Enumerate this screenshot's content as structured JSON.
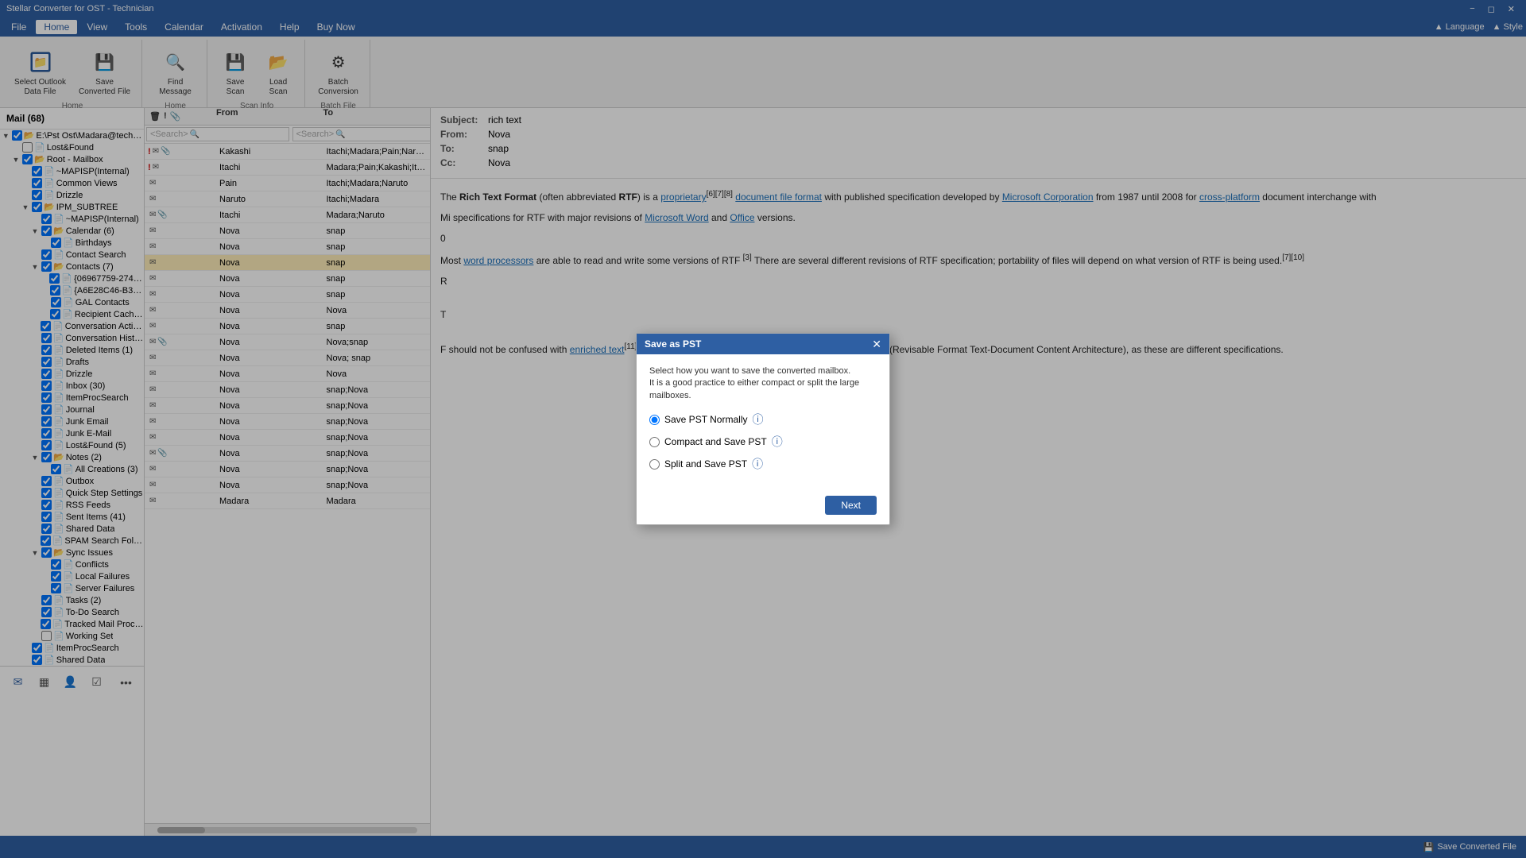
{
  "titleBar": {
    "title": "Stellar Converter for OST - Technician",
    "controls": [
      "minimize",
      "restore",
      "close"
    ]
  },
  "menuBar": {
    "items": [
      {
        "label": "File",
        "active": false
      },
      {
        "label": "Home",
        "active": true
      },
      {
        "label": "View",
        "active": false
      },
      {
        "label": "Tools",
        "active": false
      },
      {
        "label": "Calendar",
        "active": false
      },
      {
        "label": "Activation",
        "active": false
      },
      {
        "label": "Help",
        "active": false
      },
      {
        "label": "Buy Now",
        "active": false
      }
    ],
    "right": [
      {
        "label": "▲ Language"
      },
      {
        "label": "▲ Style"
      }
    ]
  },
  "ribbon": {
    "groups": [
      {
        "label": "Home",
        "buttons": [
          {
            "id": "select-outlook",
            "icon": "📁",
            "label": "Select Outlook\nData File"
          },
          {
            "id": "save-converted",
            "icon": "💾",
            "label": "Save\nConverted File"
          }
        ]
      },
      {
        "label": "Home",
        "buttons": [
          {
            "id": "find-message",
            "icon": "🔍",
            "label": "Find\nMessage"
          }
        ]
      },
      {
        "label": "Scan Info",
        "buttons": [
          {
            "id": "save-scan",
            "icon": "💾",
            "label": "Save\nScan"
          },
          {
            "id": "load-scan",
            "icon": "📂",
            "label": "Load\nScan"
          }
        ]
      },
      {
        "label": "Batch File",
        "buttons": [
          {
            "id": "batch-conversion",
            "icon": "⚙",
            "label": "Batch\nConversion"
          }
        ]
      }
    ]
  },
  "sidebar": {
    "header": "Mail (68)",
    "tree": [
      {
        "id": "root",
        "label": "E:\\Pst Ost\\Madara@tech.com -",
        "level": 0,
        "checked": true,
        "expanded": true,
        "hasChildren": true
      },
      {
        "id": "lost-found",
        "label": "Lost&Found",
        "level": 1,
        "checked": false,
        "expanded": false,
        "hasChildren": false
      },
      {
        "id": "root-mailbox",
        "label": "Root - Mailbox",
        "level": 1,
        "checked": true,
        "expanded": true,
        "hasChildren": true
      },
      {
        "id": "mapisp-internal",
        "label": "~MAPISP(Internal)",
        "level": 2,
        "checked": true,
        "expanded": false,
        "hasChildren": false
      },
      {
        "id": "common-views",
        "label": "Common Views",
        "level": 2,
        "checked": true,
        "expanded": false,
        "hasChildren": false
      },
      {
        "id": "drizzle",
        "label": "Drizzle",
        "level": 2,
        "checked": true,
        "expanded": false,
        "hasChildren": false
      },
      {
        "id": "ipm-subtree",
        "label": "IPM_SUBTREE",
        "level": 2,
        "checked": true,
        "expanded": true,
        "hasChildren": true
      },
      {
        "id": "mapisp-internal2",
        "label": "~MAPISP(Internal)",
        "level": 3,
        "checked": true,
        "expanded": false,
        "hasChildren": false
      },
      {
        "id": "calendar",
        "label": "Calendar (6)",
        "level": 3,
        "checked": true,
        "expanded": true,
        "hasChildren": true
      },
      {
        "id": "birthdays",
        "label": "Birthdays",
        "level": 4,
        "checked": true,
        "expanded": false,
        "hasChildren": false
      },
      {
        "id": "contact-search",
        "label": "Contact Search",
        "level": 3,
        "checked": true,
        "expanded": false,
        "hasChildren": false
      },
      {
        "id": "contacts7",
        "label": "Contacts (7)",
        "level": 3,
        "checked": true,
        "expanded": true,
        "hasChildren": true
      },
      {
        "id": "contact1",
        "label": "{06967759-274D-4...",
        "level": 4,
        "checked": true,
        "expanded": false,
        "hasChildren": false
      },
      {
        "id": "contact2",
        "label": "{A6E28C46-B3A0-...",
        "level": 4,
        "checked": true,
        "expanded": false,
        "hasChildren": false
      },
      {
        "id": "gal-contacts",
        "label": "GAL Contacts",
        "level": 4,
        "checked": true,
        "expanded": false,
        "hasChildren": false
      },
      {
        "id": "recipient-cache",
        "label": "Recipient Cache (5",
        "level": 4,
        "checked": true,
        "expanded": false,
        "hasChildren": false
      },
      {
        "id": "conversation-action",
        "label": "Conversation Action S",
        "level": 3,
        "checked": true,
        "expanded": false,
        "hasChildren": false
      },
      {
        "id": "conversation-history",
        "label": "Conversation History",
        "level": 3,
        "checked": true,
        "expanded": false,
        "hasChildren": false
      },
      {
        "id": "deleted-items",
        "label": "Deleted Items (1)",
        "level": 3,
        "checked": true,
        "expanded": false,
        "hasChildren": false
      },
      {
        "id": "drafts",
        "label": "Drafts",
        "level": 3,
        "checked": true,
        "expanded": false,
        "hasChildren": false
      },
      {
        "id": "drizzle2",
        "label": "Drizzle",
        "level": 3,
        "checked": true,
        "expanded": false,
        "hasChildren": false
      },
      {
        "id": "inbox30",
        "label": "Inbox (30)",
        "level": 3,
        "checked": true,
        "expanded": false,
        "hasChildren": false
      },
      {
        "id": "item-proc-search",
        "label": "ItemProcSearch",
        "level": 3,
        "checked": true,
        "expanded": false,
        "hasChildren": false
      },
      {
        "id": "journal",
        "label": "Journal",
        "level": 3,
        "checked": true,
        "expanded": false,
        "hasChildren": false
      },
      {
        "id": "junk-email",
        "label": "Junk Email",
        "level": 3,
        "checked": true,
        "expanded": false,
        "hasChildren": false
      },
      {
        "id": "junk-email2",
        "label": "Junk E-Mail",
        "level": 3,
        "checked": true,
        "expanded": false,
        "hasChildren": false
      },
      {
        "id": "lost-found2",
        "label": "Lost&Found (5)",
        "level": 3,
        "checked": true,
        "expanded": false,
        "hasChildren": false
      },
      {
        "id": "notes2",
        "label": "Notes (2)",
        "level": 3,
        "checked": true,
        "expanded": true,
        "hasChildren": true
      },
      {
        "id": "all-creations",
        "label": "All Creations (3)",
        "level": 4,
        "checked": true,
        "expanded": false,
        "hasChildren": false
      },
      {
        "id": "outbox",
        "label": "Outbox",
        "level": 3,
        "checked": true,
        "expanded": false,
        "hasChildren": false
      },
      {
        "id": "quick-step",
        "label": "Quick Step Settings",
        "level": 3,
        "checked": true,
        "expanded": false,
        "hasChildren": false
      },
      {
        "id": "rss-feeds",
        "label": "RSS Feeds",
        "level": 3,
        "checked": true,
        "expanded": false,
        "hasChildren": false
      },
      {
        "id": "sent-items",
        "label": "Sent Items (41)",
        "level": 3,
        "checked": true,
        "expanded": false,
        "hasChildren": false
      },
      {
        "id": "shared-data",
        "label": "Shared Data",
        "level": 3,
        "checked": true,
        "expanded": false,
        "hasChildren": false
      },
      {
        "id": "spam-search",
        "label": "SPAM Search Folder 2",
        "level": 3,
        "checked": true,
        "expanded": false,
        "hasChildren": false
      },
      {
        "id": "sync-issues",
        "label": "Sync Issues",
        "level": 3,
        "checked": true,
        "expanded": true,
        "hasChildren": true
      },
      {
        "id": "conflicts",
        "label": "Conflicts",
        "level": 4,
        "checked": true,
        "expanded": false,
        "hasChildren": false
      },
      {
        "id": "local-failures",
        "label": "Local Failures",
        "level": 4,
        "checked": true,
        "expanded": false,
        "hasChildren": false
      },
      {
        "id": "server-failures",
        "label": "Server Failures",
        "level": 4,
        "checked": true,
        "expanded": false,
        "hasChildren": false
      },
      {
        "id": "tasks2",
        "label": "Tasks (2)",
        "level": 3,
        "checked": true,
        "expanded": false,
        "hasChildren": false
      },
      {
        "id": "to-do-search",
        "label": "To-Do Search",
        "level": 3,
        "checked": true,
        "expanded": false,
        "hasChildren": false
      },
      {
        "id": "tracked-mail",
        "label": "Tracked Mail Processin",
        "level": 3,
        "checked": true,
        "expanded": false,
        "hasChildren": false
      },
      {
        "id": "working-set",
        "label": "Working Set",
        "level": 3,
        "checked": false,
        "expanded": false,
        "hasChildren": false
      },
      {
        "id": "item-proc-search2",
        "label": "ItemProcSearch",
        "level": 2,
        "checked": true,
        "expanded": false,
        "hasChildren": false
      },
      {
        "id": "shared-data2",
        "label": "Shared Data",
        "level": 2,
        "checked": true,
        "expanded": false,
        "hasChildren": false
      }
    ],
    "navButtons": [
      {
        "id": "mail",
        "icon": "✉",
        "active": true
      },
      {
        "id": "calendar",
        "icon": "📅",
        "active": false
      },
      {
        "id": "people",
        "icon": "👤",
        "active": false
      },
      {
        "id": "tasks",
        "icon": "✔",
        "active": false
      },
      {
        "id": "more",
        "icon": "•••",
        "active": false
      }
    ]
  },
  "mailList": {
    "columns": [
      {
        "id": "icons",
        "label": ""
      },
      {
        "id": "from",
        "label": "From"
      },
      {
        "id": "to",
        "label": "To"
      }
    ],
    "searchPlaceholder": "<Search>",
    "rows": [
      {
        "id": 1,
        "exclaim": "!",
        "icons": [
          "msg",
          "attach"
        ],
        "from": "Kakashi",
        "to": "Itachi;Madara;Pain;Naruto"
      },
      {
        "id": 2,
        "exclaim": "!",
        "icons": [
          "msg"
        ],
        "from": "Itachi",
        "to": "Madara;Pain;Kakashi;Itachi"
      },
      {
        "id": 3,
        "exclaim": "",
        "icons": [],
        "from": "Pain",
        "to": "Itachi;Madara;Naruto"
      },
      {
        "id": 4,
        "exclaim": "",
        "icons": [],
        "from": "Naruto",
        "to": "Itachi;Madara"
      },
      {
        "id": 5,
        "exclaim": "",
        "icons": [
          "attach"
        ],
        "from": "Itachi",
        "to": "Madara;Naruto"
      },
      {
        "id": 6,
        "exclaim": "",
        "icons": [],
        "from": "Nova",
        "to": "snap"
      },
      {
        "id": 7,
        "exclaim": "",
        "icons": [],
        "from": "Nova",
        "to": "snap"
      },
      {
        "id": 8,
        "exclaim": "",
        "icons": [],
        "from": "Nova",
        "to": "snap",
        "selected": true,
        "highlighted": true
      },
      {
        "id": 9,
        "exclaim": "",
        "icons": [],
        "from": "Nova",
        "to": "snap"
      },
      {
        "id": 10,
        "exclaim": "",
        "icons": [],
        "from": "Nova",
        "to": "snap"
      },
      {
        "id": 11,
        "exclaim": "",
        "icons": [],
        "from": "Nova",
        "to": "Nova"
      },
      {
        "id": 12,
        "exclaim": "",
        "icons": [],
        "from": "Nova",
        "to": "snap"
      },
      {
        "id": 13,
        "exclaim": "",
        "icons": [
          "attach"
        ],
        "from": "Nova",
        "to": "Nova;snap"
      },
      {
        "id": 14,
        "exclaim": "",
        "icons": [],
        "from": "Nova",
        "to": "Nova; snap"
      },
      {
        "id": 15,
        "exclaim": "",
        "icons": [],
        "from": "Nova",
        "to": "Nova"
      },
      {
        "id": 16,
        "exclaim": "",
        "icons": [],
        "from": "Nova",
        "to": "snap;Nova"
      },
      {
        "id": 17,
        "exclaim": "",
        "icons": [],
        "from": "Nova",
        "to": "snap;Nova"
      },
      {
        "id": 18,
        "exclaim": "",
        "icons": [],
        "from": "Nova",
        "to": "snap;Nova"
      },
      {
        "id": 19,
        "exclaim": "",
        "icons": [],
        "from": "Nova",
        "to": "snap;Nova"
      },
      {
        "id": 20,
        "exclaim": "",
        "icons": [
          "attach"
        ],
        "from": "Nova",
        "to": "snap;Nova"
      },
      {
        "id": 21,
        "exclaim": "",
        "icons": [],
        "from": "Nova",
        "to": "snap;Nova"
      },
      {
        "id": 22,
        "exclaim": "",
        "icons": [],
        "from": "Nova",
        "to": "snap;Nova"
      },
      {
        "id": 23,
        "exclaim": "",
        "icons": [],
        "from": "Madara",
        "to": "Madara"
      }
    ]
  },
  "readingPane": {
    "subject": "rich text",
    "from": "Nova",
    "to": "snap",
    "cc": "Nova",
    "body": {
      "paragraph1": "The Rich Text Format (often abbreviated RTF) is a proprietary document file format with published specification developed by Microsoft Corporation from 1987 until 2008 for cross-platform document interchange with",
      "paragraph2": "Most word processors are able to read and write some versions of RTF. There are several different revisions of RTF specification; portability of files will depend on what version of RTF is being used.",
      "paragraph3": "F should not be confused with enriched text or its predecessor Rich Text, or with IBM's RFT-DCA (Revisable Format Text-Document Content Architecture), as these are different specifications."
    }
  },
  "dialog": {
    "title": "Save as PST",
    "description": "Select how you want to save the converted mailbox.\nIt is a good practice to either compact or split the large mailboxes.",
    "options": [
      {
        "id": "normal",
        "label": "Save PST Normally",
        "checked": true
      },
      {
        "id": "compact",
        "label": "Compact and Save PST",
        "checked": false
      },
      {
        "id": "split",
        "label": "Split and Save PST",
        "checked": false
      }
    ],
    "nextButton": "Next"
  },
  "statusBar": {
    "saveButton": "Save Converted File"
  }
}
